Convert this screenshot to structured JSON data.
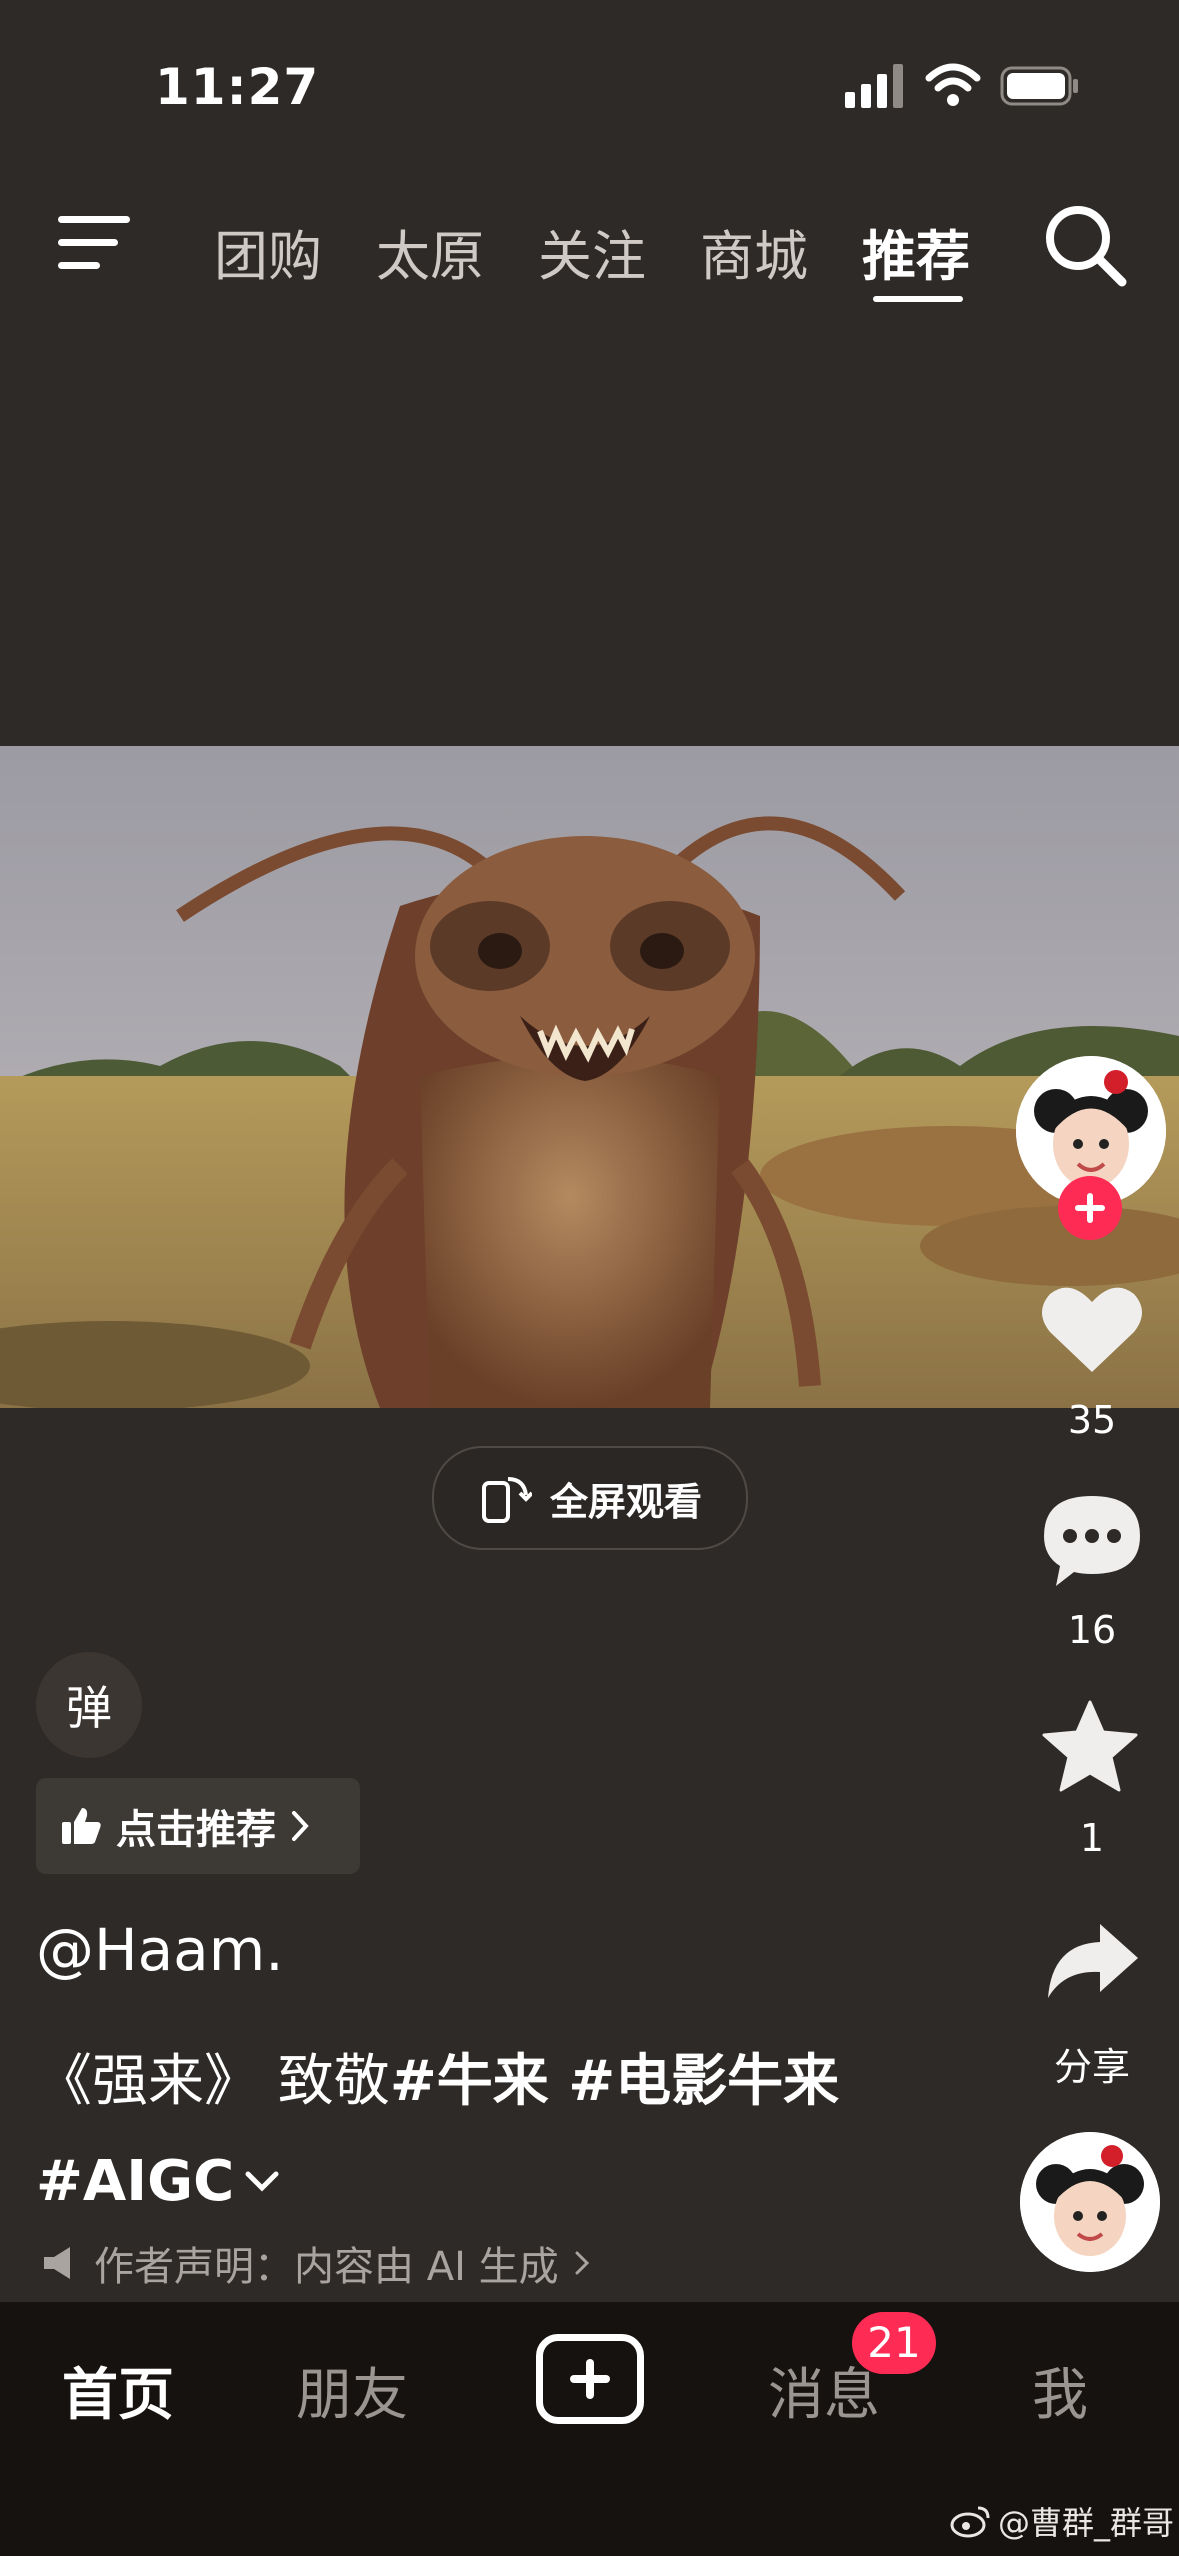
{
  "status_bar": {
    "time": "11:27"
  },
  "top_nav": {
    "tabs": [
      {
        "label": "团购"
      },
      {
        "label": "太原"
      },
      {
        "label": "关注"
      },
      {
        "label": "商城"
      },
      {
        "label": "推荐"
      }
    ],
    "active_tab": "推荐"
  },
  "player": {
    "fullscreen_label": "全屏观看"
  },
  "side_rail": {
    "likes": "35",
    "comments": "16",
    "favorites": "1",
    "share_label": "分享"
  },
  "danmu_label": "弹",
  "recommend_label": "点击推荐",
  "post": {
    "author": "@Haam.",
    "title_part": "《强来》 致敬",
    "tags_line1": "#牛来 #电影牛来",
    "tags_line2": "#AIGC",
    "declaration": "作者声明：内容由 AI 生成"
  },
  "bottom_nav": {
    "home": "首页",
    "friends": "朋友",
    "messages": "消息",
    "me": "我",
    "messages_badge": "21"
  },
  "watermark": "@曹群_群哥",
  "colors": {
    "accent": "#fe2c55",
    "background": "#2e2a27",
    "bottom_bar": "#16120f"
  }
}
